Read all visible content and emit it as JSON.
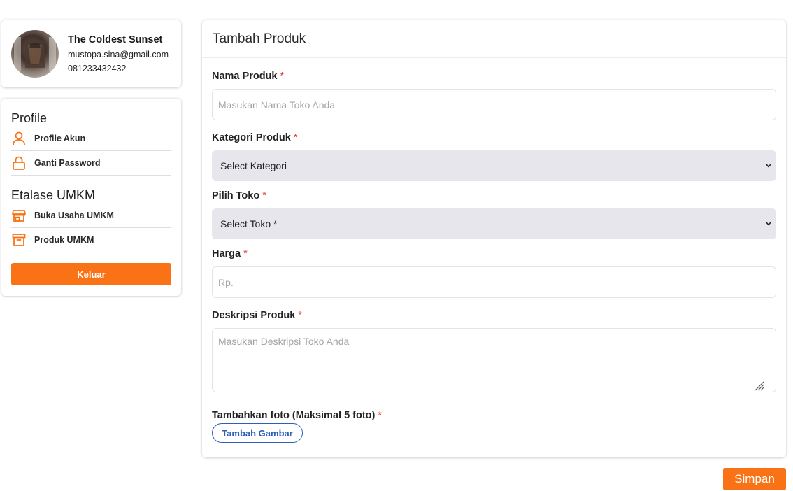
{
  "user": {
    "name": "The Coldest Sunset",
    "email": "mustopa.sina@gmail.com",
    "phone": "081233432432"
  },
  "sidebar": {
    "sections": [
      {
        "title": "Profile",
        "items": [
          {
            "label": "Profile Akun",
            "icon": "user-icon"
          },
          {
            "label": "Ganti Password",
            "icon": "lock-icon"
          }
        ]
      },
      {
        "title": "Etalase UMKM",
        "items": [
          {
            "label": "Buka Usaha UMKM",
            "icon": "store-icon"
          },
          {
            "label": "Produk UMKM",
            "icon": "archive-icon"
          }
        ]
      }
    ],
    "logout_label": "Keluar"
  },
  "form": {
    "title": "Tambah Produk",
    "required_mark": "*",
    "fields": {
      "nama": {
        "label": "Nama Produk",
        "placeholder": "Masukan Nama Toko Anda"
      },
      "kategori": {
        "label": "Kategori Produk",
        "selected": "Select Kategori"
      },
      "toko": {
        "label": "Pilih Toko",
        "selected": "Select Toko *"
      },
      "harga": {
        "label": "Harga",
        "placeholder": "Rp."
      },
      "deskripsi": {
        "label": "Deskripsi Produk",
        "placeholder": "Masukan Deskripsi Toko Anda"
      },
      "foto": {
        "label": "Tambahkan foto (Maksimal 5 foto)",
        "button_label": "Tambah Gambar"
      }
    },
    "save_label": "Simpan"
  },
  "colors": {
    "accent": "#f97316",
    "required": "#e53935",
    "link_blue": "#2c5fb8",
    "select_bg": "#e7e6ec"
  }
}
